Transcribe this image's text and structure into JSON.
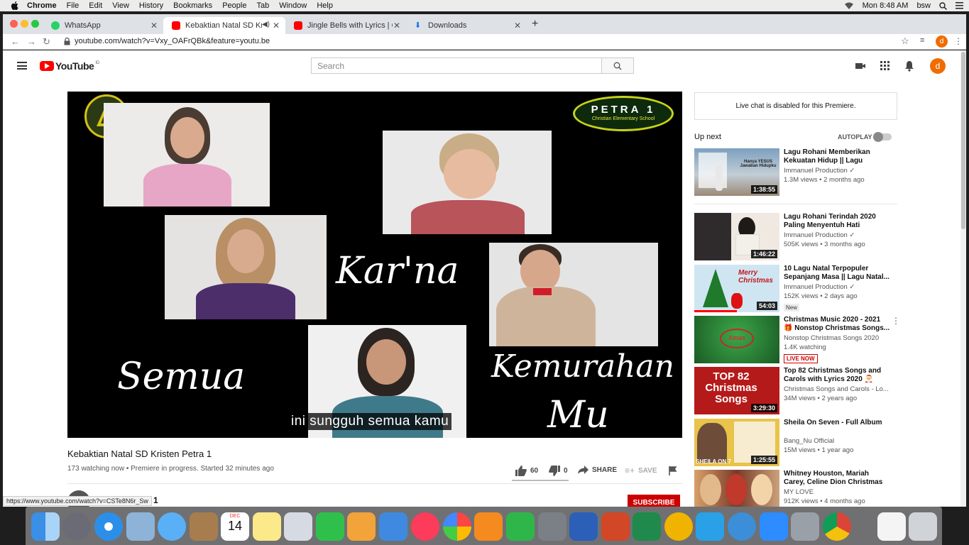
{
  "menubar": {
    "app": "Chrome",
    "items": [
      "File",
      "Edit",
      "View",
      "History",
      "Bookmarks",
      "People",
      "Tab",
      "Window",
      "Help"
    ],
    "clock": "Mon 8:48 AM",
    "user": "bsw"
  },
  "tabs": [
    {
      "label": "WhatsApp",
      "icon": "whatsapp-icon"
    },
    {
      "label": "Kebaktian Natal SD Kristen",
      "icon": "youtube-icon"
    },
    {
      "label": "Jingle Bells with Lyrics | Christ",
      "icon": "youtube-icon"
    },
    {
      "label": "Downloads",
      "icon": "download-icon"
    }
  ],
  "address": {
    "url": "youtube.com/watch?v=Vxy_OAFrQBk&feature=youtu.be"
  },
  "youtube": {
    "logo_text": "YouTube",
    "logo_country": "ID",
    "search_placeholder": "Search",
    "avatar_letter": "d"
  },
  "video": {
    "title": "Kebaktian Natal SD Kristen Petra 1",
    "meta": "173 watching now • Premiere in progress. Started 32 minutes ago",
    "likes": "60",
    "dislikes": "0",
    "share": "SHARE",
    "save": "SAVE",
    "subtitle": "ini sungguh semua kamu",
    "overlay_words": [
      "Kar'na",
      "Semua",
      "Kemurahan",
      "Mu"
    ],
    "school_logo_line1": "PETRA 1",
    "school_logo_line2": "Christian Elementary School",
    "subscribe": "SUBSCRIBE",
    "channel_partial": "1"
  },
  "sidebar": {
    "chat_disabled": "Live chat is disabled for this Premiere.",
    "up_next": "Up next",
    "autoplay": "AUTOPLAY",
    "items": [
      {
        "title": "Lagu Rohani Memberikan Kekuatan Hidup || Lagu Rohani...",
        "channel": "Immanuel Production ✓",
        "views": "1.3M views • 2 months ago",
        "duration": "1:38:55",
        "tag": ""
      },
      {
        "title": "Lagu Rohani Terindah 2020 Paling Menyentuh Hati",
        "channel": "Immanuel Production ✓",
        "views": "505K views • 3 months ago",
        "duration": "1:46:22",
        "tag": ""
      },
      {
        "title": "10 Lagu Natal Terpopuler Sepanjang Masa || Lagu Natal...",
        "channel": "Immanuel Production ✓",
        "views": "152K views • 2 days ago",
        "duration": "54:03",
        "tag": "New"
      },
      {
        "title": "Christmas Music 2020 - 2021 🎁 Nonstop Christmas Songs...",
        "channel": "Nonstop Christmas Songs 2020",
        "views": "1.4K watching",
        "duration": "",
        "tag": "LIVE NOW"
      },
      {
        "title": "Top 82 Christmas Songs and Carols with Lyrics 2020 🎅",
        "channel": "Christmas Songs and Carols - Lo...",
        "views": "34M views • 2 years ago",
        "duration": "3:29:30",
        "tag": ""
      },
      {
        "title": "Sheila On Seven - Full Album",
        "channel": "Bang_Nu Official",
        "views": "15M views • 1 year ago",
        "duration": "1:25:55",
        "tag": ""
      },
      {
        "title": "Whitney Houston, Mariah Carey, Celine Dion Christmas Music...",
        "channel": "MY LOVE",
        "views": "912K views • 4 months ago",
        "duration": "",
        "tag": ""
      }
    ],
    "thumb_texts": [
      "Hanya YESUS Jawaban Hidupku",
      "Merry Christmas",
      "TOP 82 Christmas Songs",
      "SHEILA ON 7"
    ]
  },
  "status_url": "https://www.youtube.com/watch?v=CSTe8N6r_Sw",
  "dock": {
    "calendar_month": "DEC",
    "calendar_day": "14"
  },
  "colors": {
    "youtube_red": "#ff0000",
    "avatar": "#ef6c00",
    "subscribe": "#cc0000"
  }
}
